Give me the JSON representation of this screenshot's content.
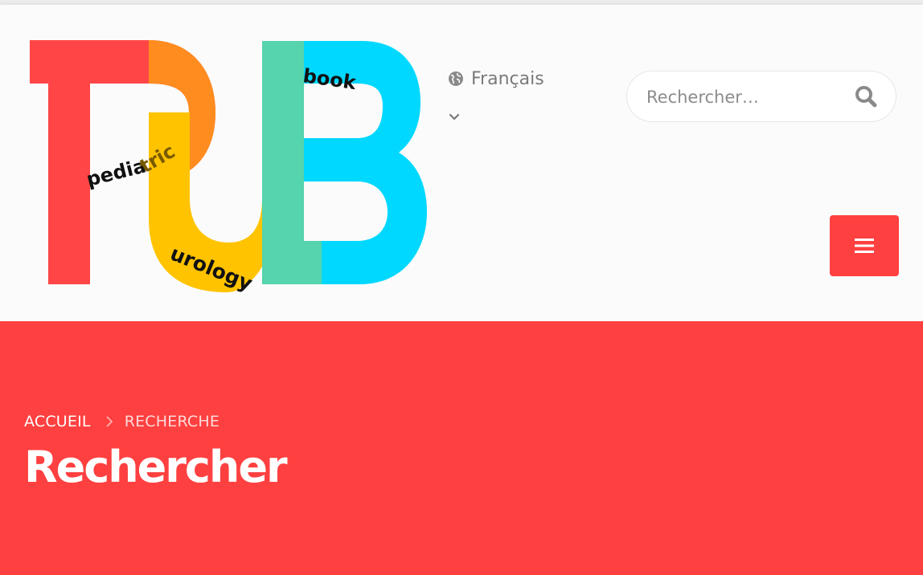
{
  "logo": {
    "word_pediatric": "pediatric",
    "word_urology": "urology",
    "word_book": "book",
    "colors": {
      "p": "#ff4545",
      "p_bowl": "#ff8c1f",
      "u": "#ffc300",
      "b_stem": "#55d4ad",
      "b_bowl": "#00d8ff"
    }
  },
  "language": {
    "icon": "globe-icon",
    "label": "Français",
    "dropdown_icon": "chevron-down-icon"
  },
  "search": {
    "placeholder": "Rechercher…",
    "value": "",
    "icon": "search-icon"
  },
  "menu": {
    "icon": "hamburger-icon"
  },
  "breadcrumb": {
    "home": "ACCUEIL",
    "current": "RECHERCHE",
    "separator_icon": "chevron-right-icon"
  },
  "page": {
    "title": "Rechercher"
  },
  "colors": {
    "accent": "#ff4040",
    "header_bg": "#fbfbfb"
  }
}
